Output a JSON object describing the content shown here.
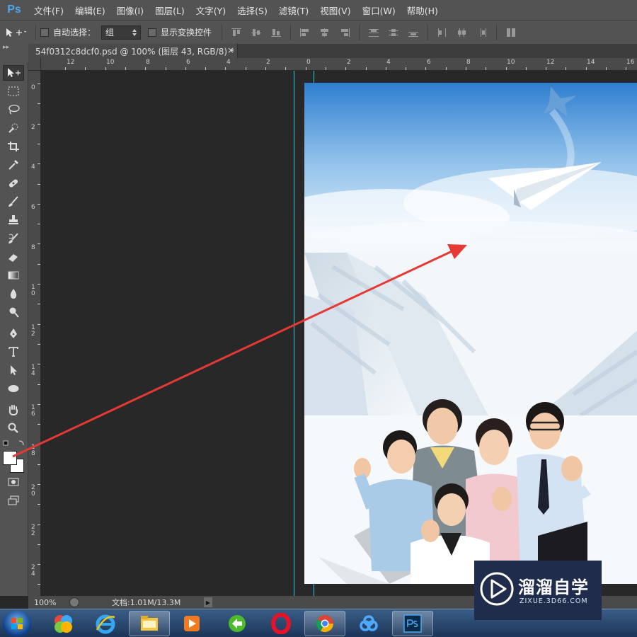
{
  "app": {
    "logo": "Ps"
  },
  "menu": [
    "文件(F)",
    "编辑(E)",
    "图像(I)",
    "图层(L)",
    "文字(Y)",
    "选择(S)",
    "滤镜(T)",
    "视图(V)",
    "窗口(W)",
    "帮助(H)"
  ],
  "options": {
    "auto_select_label": "自动选择：",
    "auto_select_value": "组",
    "show_transform_label": "显示变换控件"
  },
  "document": {
    "tab_title": "54f0312c8dcf0.psd @ 100% (图层 43, RGB/8) *",
    "tab_close": "×"
  },
  "ruler": {
    "horizontal_labels": [
      "12",
      "10",
      "8",
      "6",
      "4",
      "2",
      "0",
      "2",
      "4",
      "6",
      "8",
      "10",
      "12",
      "14",
      "16"
    ],
    "vertical_labels": [
      "0",
      "2",
      "4",
      "6",
      "8",
      "1\n0",
      "1\n2",
      "1\n4",
      "1\n6",
      "1\n8",
      "2\n0",
      "2\n2",
      "2\n4"
    ]
  },
  "status": {
    "zoom": "100%",
    "doc_size": "文档:1.01M/13.3M"
  },
  "watermark": {
    "name": "溜溜自学",
    "url": "ZIXUE.3D66.COM"
  },
  "colors": {
    "panel": "#535353",
    "canvas_bg": "#282828",
    "guide": "#38c8d8",
    "annotation_arrow": "#e53935",
    "sky_top": "#2f7fd0"
  },
  "tools": [
    "move-tool",
    "marquee-tool",
    "lasso-tool",
    "quick-select-tool",
    "crop-tool",
    "eyedropper-tool",
    "healing-brush-tool",
    "brush-tool",
    "clone-stamp-tool",
    "history-brush-tool",
    "eraser-tool",
    "gradient-tool",
    "blur-tool",
    "dodge-tool",
    "pen-tool",
    "type-tool",
    "path-selection-tool",
    "ellipse-tool",
    "hand-tool",
    "zoom-tool"
  ],
  "taskbar_apps": [
    "paint-app-icon",
    "internet-explorer-icon",
    "file-explorer-icon",
    "media-player-icon",
    "green-app-icon",
    "opera-icon",
    "chrome-icon",
    "baidu-netdisk-icon",
    "photoshop-icon"
  ]
}
